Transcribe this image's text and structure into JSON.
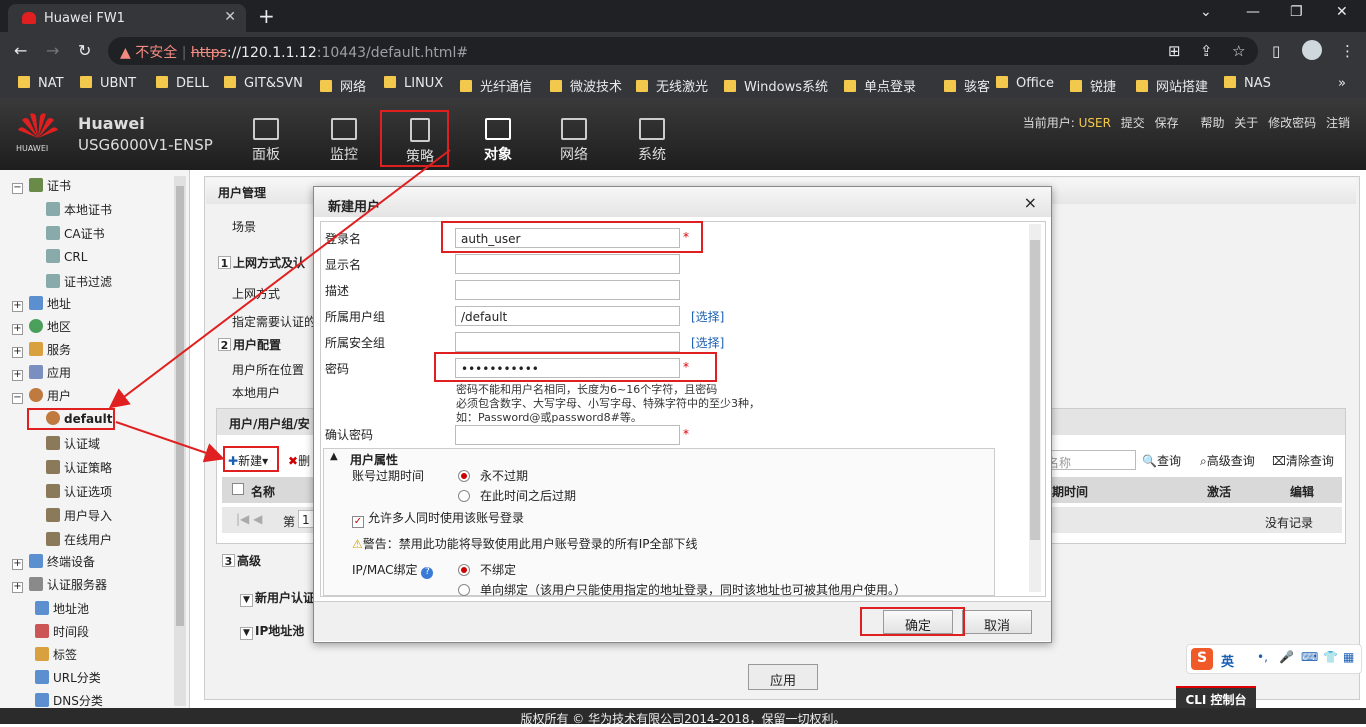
{
  "browser": {
    "tab_title": "Huawei FW1",
    "new_tab": "+",
    "security_label": "不安全",
    "url_scheme": "https",
    "url_host": "://120.1.1.12",
    "url_rest": ":10443/default.html#",
    "bookmarks": [
      "NAT",
      "UBNT",
      "DELL",
      "GIT&SVN",
      "网络",
      "LINUX",
      "光纤通信",
      "微波技术",
      "无线激光",
      "Windows系统",
      "单点登录",
      "骇客",
      "Office",
      "锐捷",
      "网站搭建",
      "NAS"
    ]
  },
  "app": {
    "brand": "Huawei",
    "model": "USG6000V1-ENSP",
    "logo_text": "HUAWEI",
    "menu": [
      "面板",
      "监控",
      "策略",
      "对象",
      "网络",
      "系统"
    ],
    "current_user_label": "当前用户:",
    "current_user": "USER",
    "actions": [
      "提交",
      "保存",
      "帮助",
      "关于",
      "修改密码",
      "注销"
    ]
  },
  "sidebar": {
    "items": [
      {
        "label": "证书"
      },
      {
        "label": "本地证书"
      },
      {
        "label": "CA证书"
      },
      {
        "label": "CRL"
      },
      {
        "label": "证书过滤"
      },
      {
        "label": "地址"
      },
      {
        "label": "地区"
      },
      {
        "label": "服务"
      },
      {
        "label": "应用"
      },
      {
        "label": "用户"
      },
      {
        "label": "default"
      },
      {
        "label": "认证域"
      },
      {
        "label": "认证策略"
      },
      {
        "label": "认证选项"
      },
      {
        "label": "用户导入"
      },
      {
        "label": "在线用户"
      },
      {
        "label": "终端设备"
      },
      {
        "label": "认证服务器"
      },
      {
        "label": "地址池"
      },
      {
        "label": "时间段"
      },
      {
        "label": "标签"
      },
      {
        "label": "URL分类"
      },
      {
        "label": "DNS分类"
      }
    ]
  },
  "content": {
    "title": "用户管理",
    "scene": "场景",
    "sec1": "上网方式及认",
    "sec1_num": "1",
    "online_mode": "上网方式",
    "auth_specify": "指定需要认证的",
    "sec2_num": "2",
    "sec2": "用户配置",
    "user_location": "用户所在位置",
    "local_user": "本地用户",
    "list_title": "用户/用户组/安",
    "new_btn": "新建",
    "delete_btn": "删",
    "search_placeholder": "名称",
    "query": "查询",
    "adv_query": "高级查询",
    "clear_query": "清除查询",
    "col_name": "名称",
    "col_expire": "期时间",
    "col_activate": "激活",
    "col_edit": "编辑",
    "page_label": "第",
    "page_num": "1",
    "no_records": "没有记录",
    "sec3_num": "3",
    "sec3": "高级",
    "new_user_auth": "新用户认证",
    "ip_pool": "IP地址池",
    "apply": "应用"
  },
  "dialog": {
    "title": "新建用户",
    "close": "×",
    "login_name_label": "登录名",
    "login_name_value": "auth_user",
    "display_name_label": "显示名",
    "desc_label": "描述",
    "group_label": "所属用户组",
    "group_value": "/default",
    "sec_group_label": "所属安全组",
    "select_link": "[选择]",
    "password_label": "密码",
    "password_value": "•••••••••••",
    "hint1": "密码不能和用户名相同，长度为6~16个字符，且密码",
    "hint2": "必须包含数字、大写字母、小写字母、特殊字符中的至少3种，",
    "hint3": "如：Password@或password8#等。",
    "confirm_label": "确认密码",
    "required": "*",
    "attr_title": "用户属性",
    "expire_label": "账号过期时间",
    "never_expire": "永不过期",
    "expire_after": "在此时间之后过期",
    "multi_login": "允许多人同时使用该账号登录",
    "warning": "警告：禁用此功能将导致使用此用户账号登录的所有IP全部下线",
    "ipmac_label": "IP/MAC绑定",
    "no_bind": "不绑定",
    "one_way_bind": "单向绑定（该用户只能使用指定的地址登录，同时该地址也可被其他用户使用。）",
    "ok": "确定",
    "cancel": "取消"
  },
  "footer": {
    "copyright": "版权所有 © 华为技术有限公司2014-2018，保留一切权利。",
    "cli": "CLI 控制台"
  },
  "ime": {
    "lang": "英"
  },
  "colors": {
    "annotation_red": "#e02020",
    "header_dark": "#1e1e1e",
    "user_yellow": "#f7c948"
  }
}
